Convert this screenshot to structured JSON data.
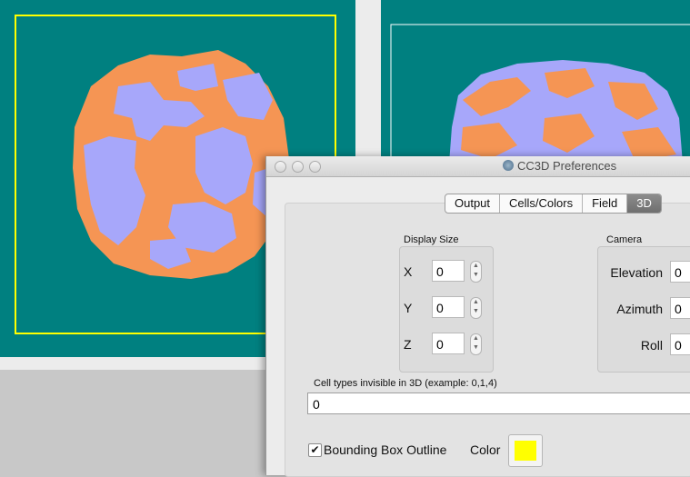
{
  "dialog": {
    "title": "CC3D Preferences",
    "tabs": [
      "Output",
      "Cells/Colors",
      "Field",
      "3D"
    ],
    "active_tab": "3D",
    "display_size": {
      "label": "Display Size",
      "x": {
        "label": "X",
        "value": "0"
      },
      "y": {
        "label": "Y",
        "value": "0"
      },
      "z": {
        "label": "Z",
        "value": "0"
      }
    },
    "camera": {
      "label": "Camera",
      "elevation": {
        "label": "Elevation",
        "value": "0"
      },
      "azimuth": {
        "label": "Azimuth",
        "value": "0"
      },
      "roll": {
        "label": "Roll",
        "value": "0"
      }
    },
    "invisible_types": {
      "label": "Cell types invisible in 3D (example: 0,1,4)",
      "value": "0"
    },
    "bounding_box": {
      "label": "Bounding Box Outline",
      "checked": true
    },
    "color": {
      "label": "Color",
      "value": "#ffff00"
    }
  },
  "colors": {
    "background_teal": "#008080",
    "cell_orange": "#f59554",
    "cell_lavender": "#a7a7fa",
    "bounding_box": "#ffff00"
  }
}
